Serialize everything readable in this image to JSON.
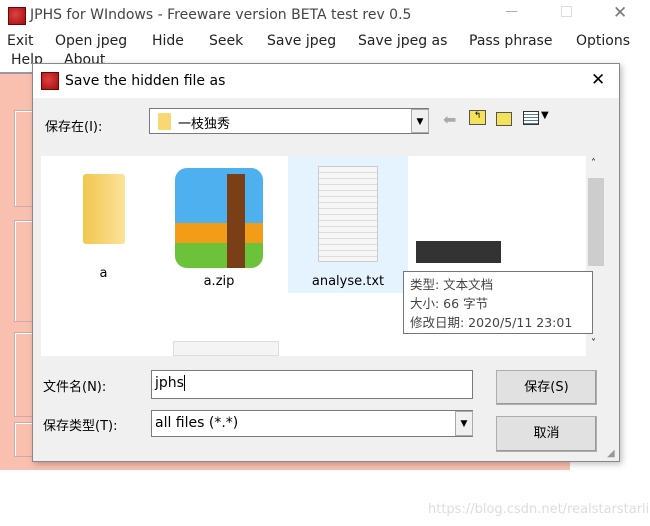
{
  "main_window": {
    "title": "JPHS for WIndows - Freeware version BETA test rev 0.5",
    "menu": [
      "Exit",
      "Open jpeg",
      "Hide",
      "Seek",
      "Save jpeg",
      "Save jpeg as",
      "Pass phrase",
      "Options",
      "Help",
      "About"
    ]
  },
  "dialog": {
    "title": "Save the hidden file as",
    "save_in_label": "保存在(I):",
    "save_in_value": "一枝独秀",
    "files": [
      {
        "name": "a",
        "type": "folder"
      },
      {
        "name": "a.zip",
        "type": "zip"
      },
      {
        "name": "analyse.txt",
        "type": "text",
        "selected": true
      }
    ],
    "tooltip": [
      "类型: 文本文档",
      "大小: 66 字节",
      "修改日期: 2020/5/11 23:01"
    ],
    "filename_label": "文件名(N):",
    "filename_value": "jphs",
    "filetype_label": "保存类型(T):",
    "filetype_value": "all files (*.*)",
    "save_button": "保存(S)",
    "cancel_button": "取消"
  },
  "watermark": "https://blog.csdn.net/realstarstarli",
  "colors": {
    "app_body": "#f9c0b0",
    "selection": "#e5f3ff"
  }
}
